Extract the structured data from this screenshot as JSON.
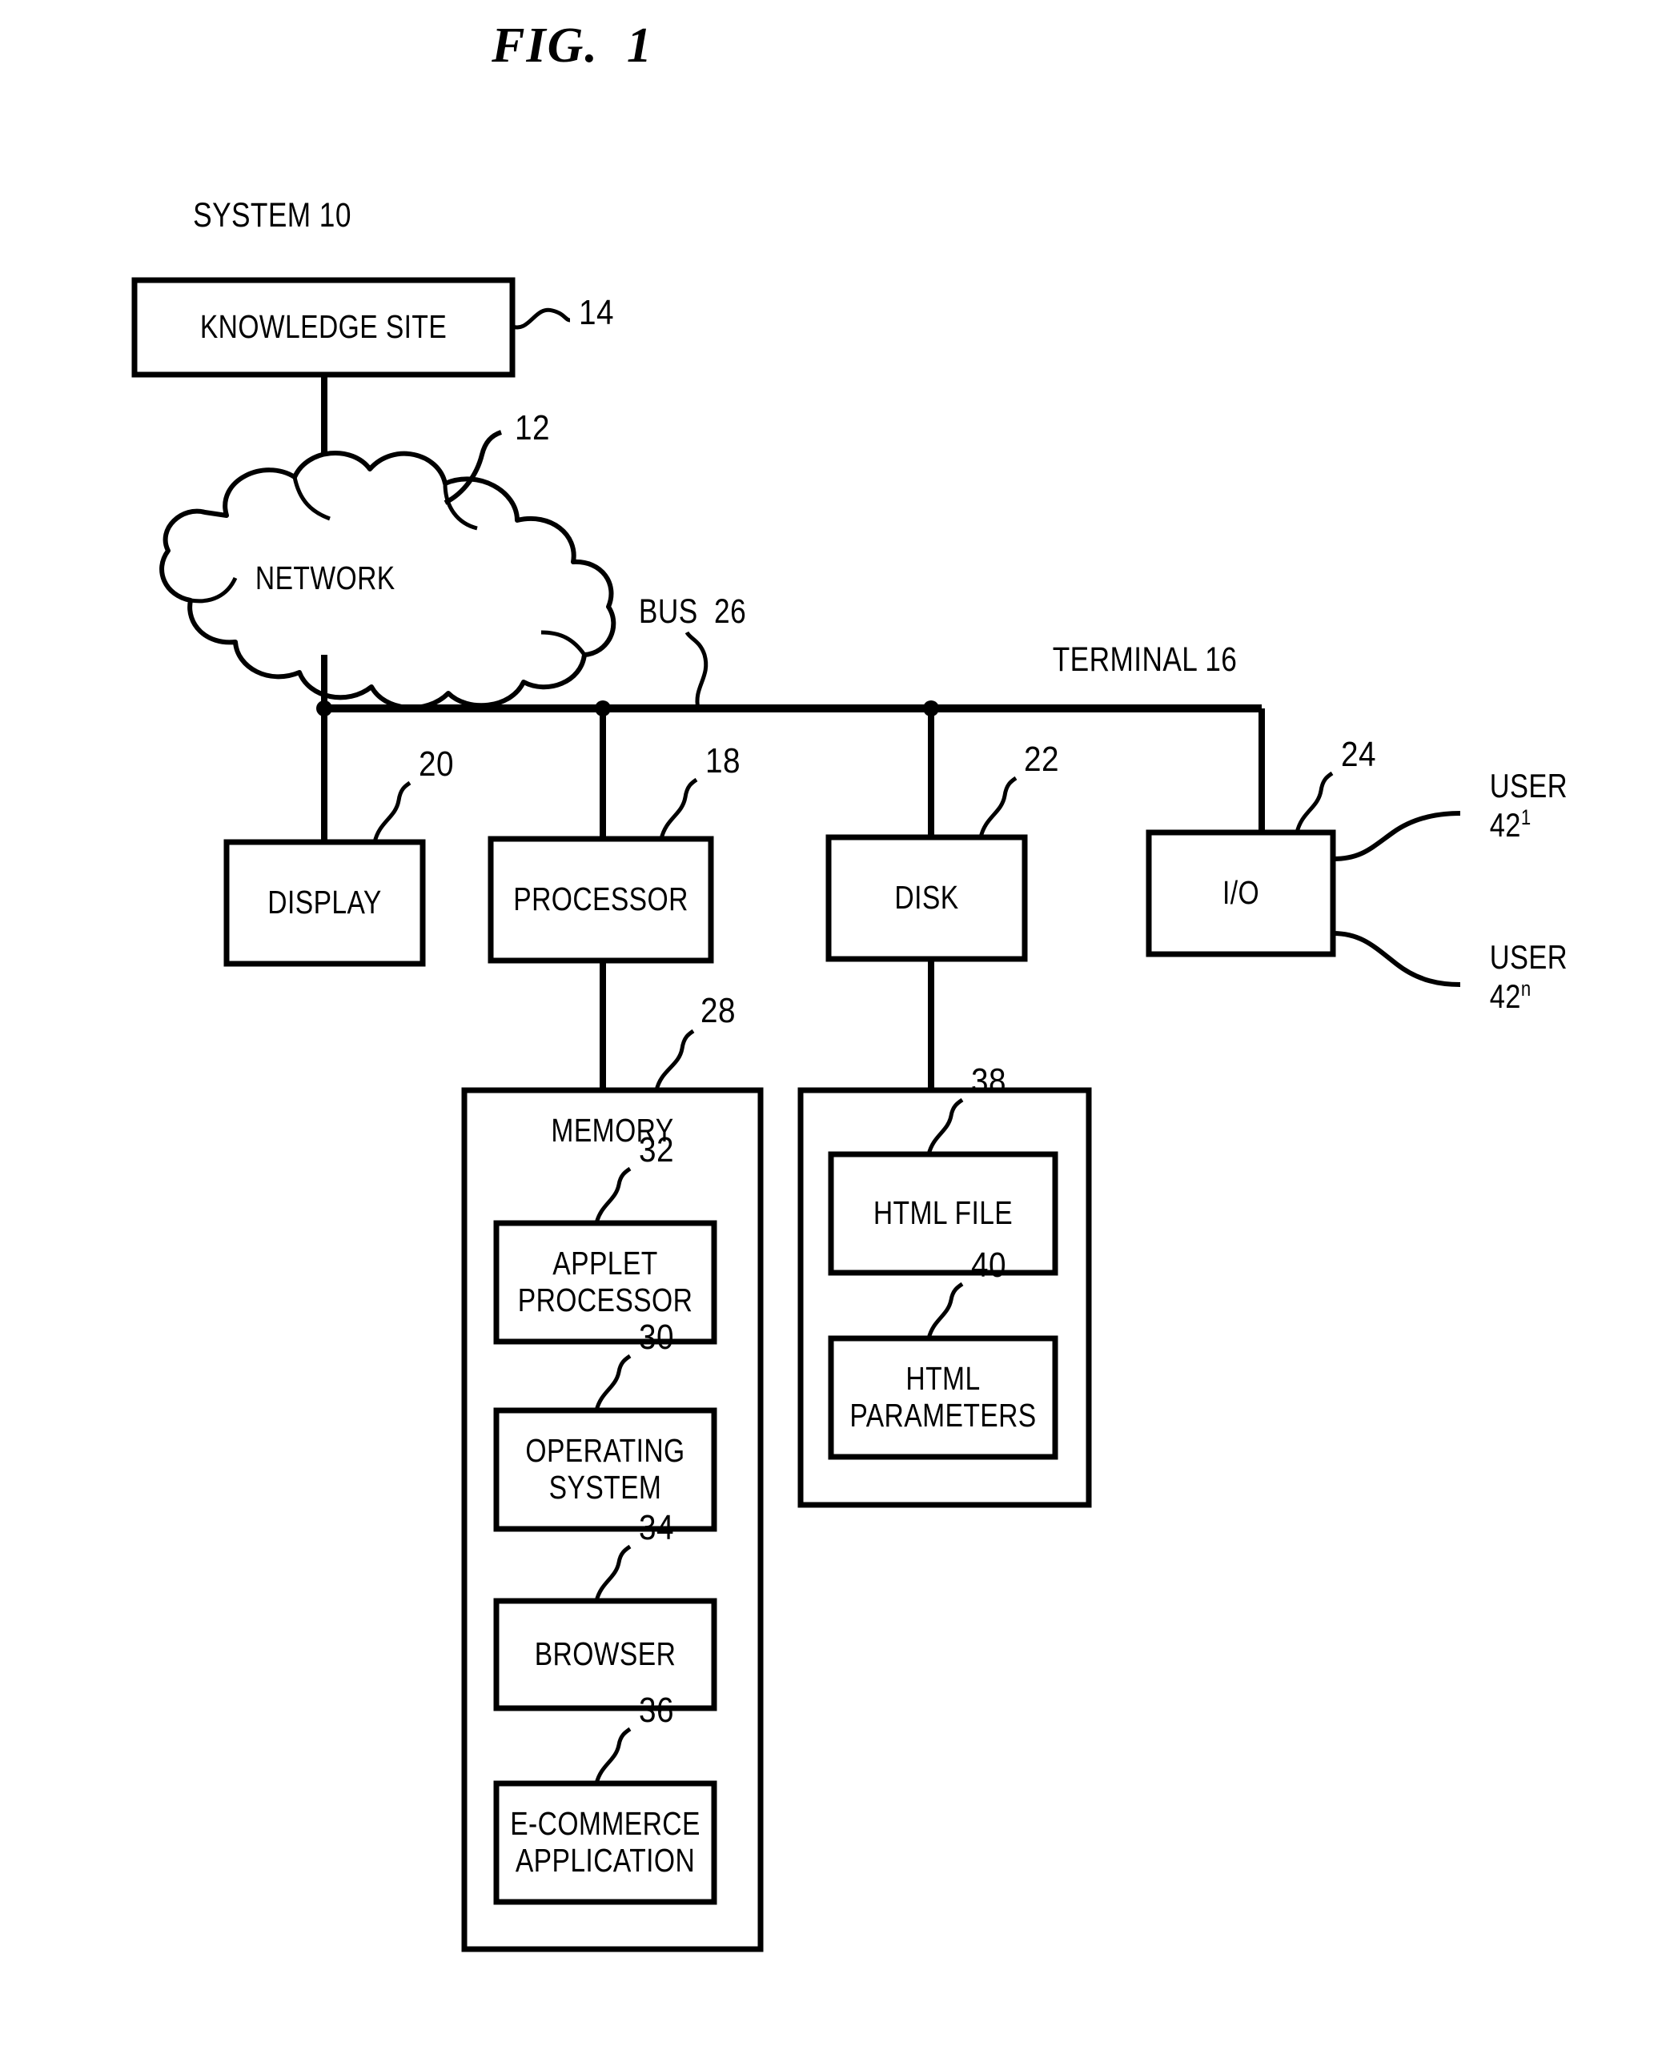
{
  "figure": {
    "title": "FIG.  1",
    "system_label": "SYSTEM 10",
    "bus_label": "BUS  26",
    "terminal_label": "TERMINAL 16"
  },
  "nodes": {
    "knowledge_site": {
      "label": "KNOWLEDGE SITE",
      "ref": "14"
    },
    "network": {
      "label": "NETWORK",
      "ref": "12"
    },
    "display": {
      "label": "DISPLAY",
      "ref": "20"
    },
    "processor": {
      "label": "PROCESSOR",
      "ref": "18"
    },
    "disk": {
      "label": "DISK",
      "ref": "22"
    },
    "io": {
      "label": "I/O",
      "ref": "24"
    },
    "memory": {
      "label": "MEMORY",
      "ref": "28"
    },
    "applet_processor": {
      "label": "APPLET\nPROCESSOR",
      "ref": "32"
    },
    "operating_system": {
      "label": "OPERATING\nSYSTEM",
      "ref": "30"
    },
    "browser": {
      "label": "BROWSER",
      "ref": "34"
    },
    "ecommerce_application": {
      "label": "E-COMMERCE\nAPPLICATION",
      "ref": "36"
    },
    "html_file": {
      "label": "HTML FILE",
      "ref": "38"
    },
    "html_parameters": {
      "label": "HTML\nPARAMETERS",
      "ref": "40"
    }
  },
  "users": {
    "first": {
      "name": "USER",
      "ref": "42",
      "index": "1"
    },
    "nth": {
      "name": "USER",
      "ref": "42",
      "index": "n"
    }
  },
  "colors": {
    "ink": "#000000",
    "paper": "#ffffff"
  }
}
